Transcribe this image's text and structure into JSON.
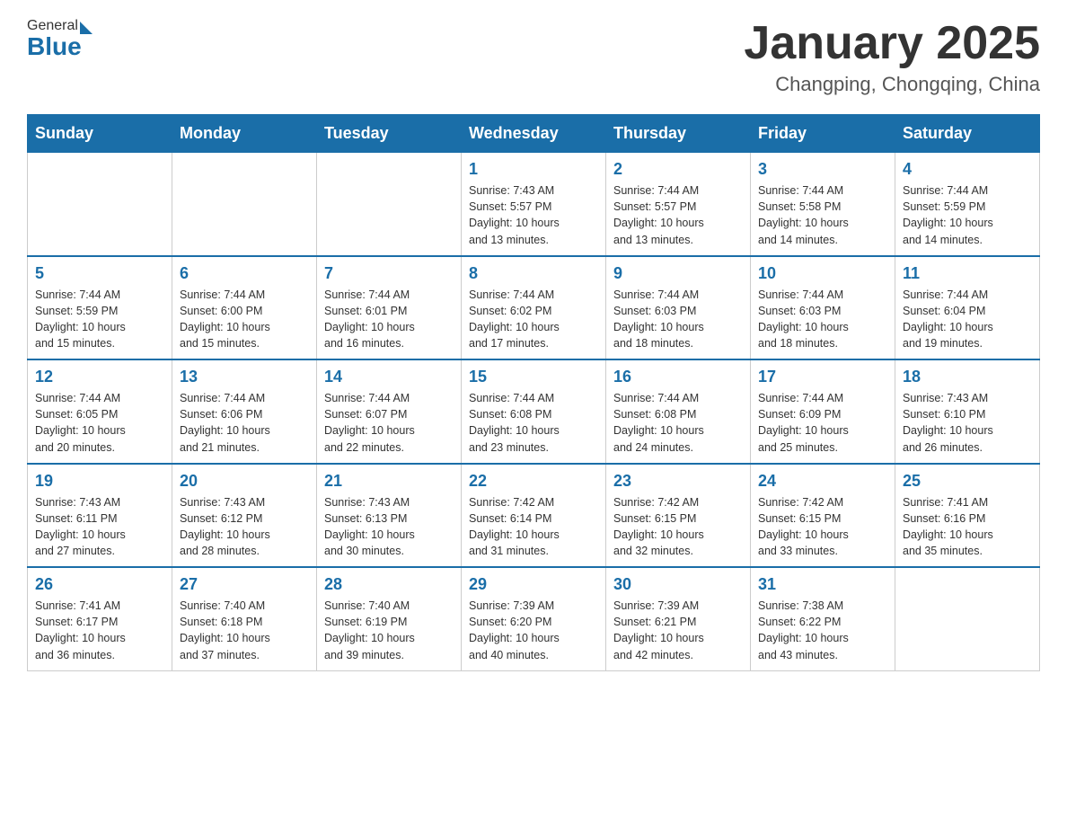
{
  "header": {
    "logo_general": "General",
    "logo_blue": "Blue",
    "month_title": "January 2025",
    "location": "Changping, Chongqing, China"
  },
  "days_of_week": [
    "Sunday",
    "Monday",
    "Tuesday",
    "Wednesday",
    "Thursday",
    "Friday",
    "Saturday"
  ],
  "weeks": [
    [
      {
        "day": "",
        "info": ""
      },
      {
        "day": "",
        "info": ""
      },
      {
        "day": "",
        "info": ""
      },
      {
        "day": "1",
        "info": "Sunrise: 7:43 AM\nSunset: 5:57 PM\nDaylight: 10 hours\nand 13 minutes."
      },
      {
        "day": "2",
        "info": "Sunrise: 7:44 AM\nSunset: 5:57 PM\nDaylight: 10 hours\nand 13 minutes."
      },
      {
        "day": "3",
        "info": "Sunrise: 7:44 AM\nSunset: 5:58 PM\nDaylight: 10 hours\nand 14 minutes."
      },
      {
        "day": "4",
        "info": "Sunrise: 7:44 AM\nSunset: 5:59 PM\nDaylight: 10 hours\nand 14 minutes."
      }
    ],
    [
      {
        "day": "5",
        "info": "Sunrise: 7:44 AM\nSunset: 5:59 PM\nDaylight: 10 hours\nand 15 minutes."
      },
      {
        "day": "6",
        "info": "Sunrise: 7:44 AM\nSunset: 6:00 PM\nDaylight: 10 hours\nand 15 minutes."
      },
      {
        "day": "7",
        "info": "Sunrise: 7:44 AM\nSunset: 6:01 PM\nDaylight: 10 hours\nand 16 minutes."
      },
      {
        "day": "8",
        "info": "Sunrise: 7:44 AM\nSunset: 6:02 PM\nDaylight: 10 hours\nand 17 minutes."
      },
      {
        "day": "9",
        "info": "Sunrise: 7:44 AM\nSunset: 6:03 PM\nDaylight: 10 hours\nand 18 minutes."
      },
      {
        "day": "10",
        "info": "Sunrise: 7:44 AM\nSunset: 6:03 PM\nDaylight: 10 hours\nand 18 minutes."
      },
      {
        "day": "11",
        "info": "Sunrise: 7:44 AM\nSunset: 6:04 PM\nDaylight: 10 hours\nand 19 minutes."
      }
    ],
    [
      {
        "day": "12",
        "info": "Sunrise: 7:44 AM\nSunset: 6:05 PM\nDaylight: 10 hours\nand 20 minutes."
      },
      {
        "day": "13",
        "info": "Sunrise: 7:44 AM\nSunset: 6:06 PM\nDaylight: 10 hours\nand 21 minutes."
      },
      {
        "day": "14",
        "info": "Sunrise: 7:44 AM\nSunset: 6:07 PM\nDaylight: 10 hours\nand 22 minutes."
      },
      {
        "day": "15",
        "info": "Sunrise: 7:44 AM\nSunset: 6:08 PM\nDaylight: 10 hours\nand 23 minutes."
      },
      {
        "day": "16",
        "info": "Sunrise: 7:44 AM\nSunset: 6:08 PM\nDaylight: 10 hours\nand 24 minutes."
      },
      {
        "day": "17",
        "info": "Sunrise: 7:44 AM\nSunset: 6:09 PM\nDaylight: 10 hours\nand 25 minutes."
      },
      {
        "day": "18",
        "info": "Sunrise: 7:43 AM\nSunset: 6:10 PM\nDaylight: 10 hours\nand 26 minutes."
      }
    ],
    [
      {
        "day": "19",
        "info": "Sunrise: 7:43 AM\nSunset: 6:11 PM\nDaylight: 10 hours\nand 27 minutes."
      },
      {
        "day": "20",
        "info": "Sunrise: 7:43 AM\nSunset: 6:12 PM\nDaylight: 10 hours\nand 28 minutes."
      },
      {
        "day": "21",
        "info": "Sunrise: 7:43 AM\nSunset: 6:13 PM\nDaylight: 10 hours\nand 30 minutes."
      },
      {
        "day": "22",
        "info": "Sunrise: 7:42 AM\nSunset: 6:14 PM\nDaylight: 10 hours\nand 31 minutes."
      },
      {
        "day": "23",
        "info": "Sunrise: 7:42 AM\nSunset: 6:15 PM\nDaylight: 10 hours\nand 32 minutes."
      },
      {
        "day": "24",
        "info": "Sunrise: 7:42 AM\nSunset: 6:15 PM\nDaylight: 10 hours\nand 33 minutes."
      },
      {
        "day": "25",
        "info": "Sunrise: 7:41 AM\nSunset: 6:16 PM\nDaylight: 10 hours\nand 35 minutes."
      }
    ],
    [
      {
        "day": "26",
        "info": "Sunrise: 7:41 AM\nSunset: 6:17 PM\nDaylight: 10 hours\nand 36 minutes."
      },
      {
        "day": "27",
        "info": "Sunrise: 7:40 AM\nSunset: 6:18 PM\nDaylight: 10 hours\nand 37 minutes."
      },
      {
        "day": "28",
        "info": "Sunrise: 7:40 AM\nSunset: 6:19 PM\nDaylight: 10 hours\nand 39 minutes."
      },
      {
        "day": "29",
        "info": "Sunrise: 7:39 AM\nSunset: 6:20 PM\nDaylight: 10 hours\nand 40 minutes."
      },
      {
        "day": "30",
        "info": "Sunrise: 7:39 AM\nSunset: 6:21 PM\nDaylight: 10 hours\nand 42 minutes."
      },
      {
        "day": "31",
        "info": "Sunrise: 7:38 AM\nSunset: 6:22 PM\nDaylight: 10 hours\nand 43 minutes."
      },
      {
        "day": "",
        "info": ""
      }
    ]
  ]
}
